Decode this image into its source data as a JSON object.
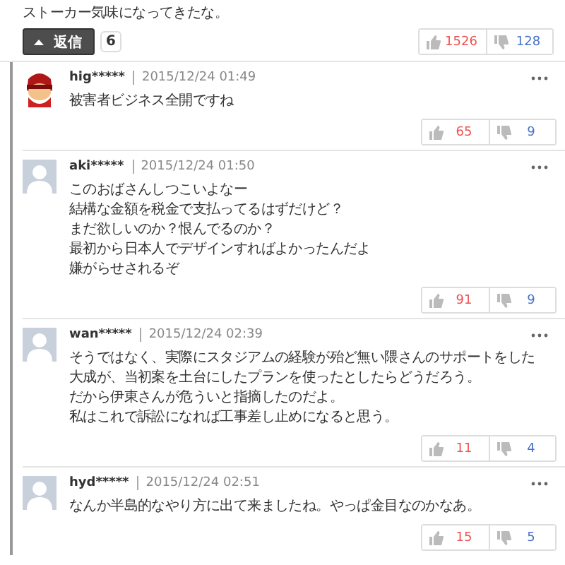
{
  "parent_comment": {
    "text": "ストーカー気味になってきたな。",
    "reply_button": "返信",
    "reply_count": "6",
    "likes": "1526",
    "dislikes": "128"
  },
  "replies": [
    {
      "avatar": {
        "kind": "character"
      },
      "user": "hig*****",
      "date": "2015/12/24 01:49",
      "lines": [
        "被害者ビジネス全開ですね"
      ],
      "likes": "65",
      "dislikes": "9"
    },
    {
      "avatar": {
        "kind": "default"
      },
      "user": "aki*****",
      "date": "2015/12/24 01:50",
      "lines": [
        "このおばさんしつこいよなー",
        "結構な金額を税金で支払ってるはずだけど？",
        "まだ欲しいのか？恨んでるのか？",
        "最初から日本人でデザインすればよかったんだよ",
        "嫌がらせされるぞ"
      ],
      "likes": "91",
      "dislikes": "9"
    },
    {
      "avatar": {
        "kind": "default"
      },
      "user": "wan*****",
      "date": "2015/12/24 02:39",
      "lines": [
        "そうではなく、実際にスタジアムの経験が殆ど無い隈さんのサポートをした",
        "大成が、当初案を土台にしたプランを使ったとしたらどうだろう。",
        "だから伊東さんが危ういと指摘したのだよ。",
        "私はこれで訴訟になれば工事差し止めになると思う。"
      ],
      "likes": "11",
      "dislikes": "4"
    },
    {
      "avatar": {
        "kind": "default"
      },
      "user": "hyd*****",
      "date": "2015/12/24 02:51",
      "lines": [
        "なんか半島的なやり方に出て来ましたね。やっぱ金目なのかなあ。"
      ],
      "likes": "15",
      "dislikes": "5"
    }
  ]
}
